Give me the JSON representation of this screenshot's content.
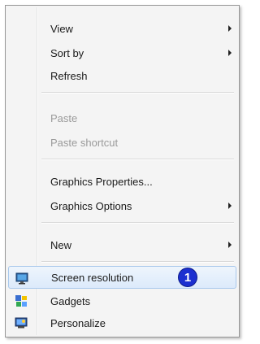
{
  "context_menu": {
    "items": [
      {
        "label": "View",
        "submenu": true
      },
      {
        "label": "Sort by",
        "submenu": true
      },
      {
        "label": "Refresh",
        "submenu": false
      },
      {
        "label": "Paste",
        "disabled": true
      },
      {
        "label": "Paste shortcut",
        "disabled": true
      },
      {
        "label": "Graphics Properties...",
        "submenu": false
      },
      {
        "label": "Graphics Options",
        "submenu": true
      },
      {
        "label": "New",
        "submenu": true
      },
      {
        "label": "Screen resolution",
        "icon": "monitor-icon",
        "highlighted": true
      },
      {
        "label": "Gadgets",
        "icon": "gadgets-icon"
      },
      {
        "label": "Personalize",
        "icon": "personalize-icon"
      }
    ]
  },
  "callout": {
    "number": "1",
    "color": "#1b2fd0"
  },
  "colors": {
    "hover_border": "#a8c8ec",
    "disabled_text": "#9a9a9a"
  }
}
